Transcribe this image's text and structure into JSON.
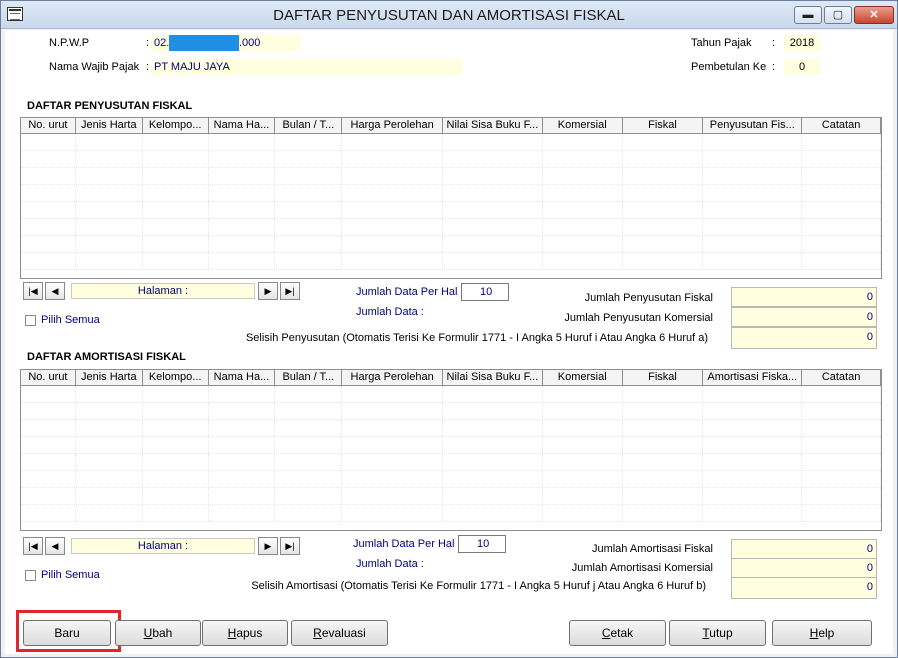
{
  "window": {
    "title": "DAFTAR PENYUSUTAN DAN AMORTISASI FISKAL",
    "min_glyph": "▬",
    "max_glyph": "▢",
    "close_glyph": "✕"
  },
  "header": {
    "npwp_label": "N.P.W.P",
    "npwp_colon": ":",
    "npwp_prefix": "02.",
    "npwp_suffix": ".000",
    "nama_label": "Nama Wajib Pajak",
    "nama_colon": ":",
    "nama_value": "PT MAJU JAYA",
    "tahun_label": "Tahun Pajak",
    "tahun_colon": ":",
    "tahun_value": "2018",
    "pembetulan_label": "Pembetulan Ke",
    "pembetulan_colon": ":",
    "pembetulan_value": "0"
  },
  "penyusutan": {
    "title": "DAFTAR PENYUSUTAN FISKAL",
    "columns": [
      "No. urut",
      "Jenis Harta",
      "Kelompo...",
      "Nama Ha...",
      "Bulan / T...",
      "Harga Perolehan",
      "Nilai Sisa Buku F...",
      "Komersial",
      "Fiskal",
      "Penyusutan Fis...",
      "Catatan"
    ],
    "pager": {
      "first": "|◀",
      "prev": "◀",
      "next": "▶",
      "last": "▶|",
      "halaman_label": "Halaman :"
    },
    "per_hal_label": "Jumlah Data Per Hal :",
    "per_hal_value": "10",
    "jumlah_data_label": "Jumlah Data :",
    "pilih_semua": "Pilih Semua",
    "sum_fiskal_label": "Jumlah Penyusutan Fiskal",
    "sum_fiskal_value": "0",
    "sum_komersial_label": "Jumlah Penyusutan Komersial",
    "sum_komersial_value": "0",
    "selisih_label": "Selisih Penyusutan (Otomatis Terisi Ke Formulir 1771 - I Angka 5 Huruf i Atau Angka 6 Huruf a)",
    "selisih_value": "0"
  },
  "amortisasi": {
    "title": "DAFTAR AMORTISASI FISKAL",
    "columns": [
      "No. urut",
      "Jenis Harta",
      "Kelompo...",
      "Nama Ha...",
      "Bulan / T...",
      "Harga Perolehan",
      "Nilai Sisa Buku F...",
      "Komersial",
      "Fiskal",
      "Amortisasi Fiska...",
      "Catatan"
    ],
    "pager": {
      "first": "|◀",
      "prev": "◀",
      "next": "▶",
      "last": "▶|",
      "halaman_label": "Halaman :"
    },
    "per_hal_label": "Jumlah Data Per Hal :",
    "per_hal_value": "10",
    "jumlah_data_label": "Jumlah Data :",
    "pilih_semua": "Pilih Semua",
    "sum_fiskal_label": "Jumlah Amortisasi Fiskal",
    "sum_fiskal_value": "0",
    "sum_komersial_label": "Jumlah Amortisasi Komersial",
    "sum_komersial_value": "0",
    "selisih_label": "Selisih Amortisasi (Otomatis Terisi Ke Formulir 1771 - I Angka 5 Huruf j Atau Angka 6 Huruf b)",
    "selisih_value": "0"
  },
  "buttons": {
    "baru": "Baru",
    "ubah_u": "U",
    "ubah_rest": "bah",
    "hapus_u": "H",
    "hapus_rest": "apus",
    "revaluasi_u": "R",
    "revaluasi_rest": "evaluasi",
    "cetak_u": "C",
    "cetak_rest": "etak",
    "tutup_u": "T",
    "tutup_rest": "utup",
    "help_u": "H",
    "help_rest": "elp"
  },
  "colors": {
    "highlight": "#e0262b",
    "field_bg": "#ffffe0",
    "text_blue": "#000080",
    "mask_blue": "#1e8fe3"
  }
}
